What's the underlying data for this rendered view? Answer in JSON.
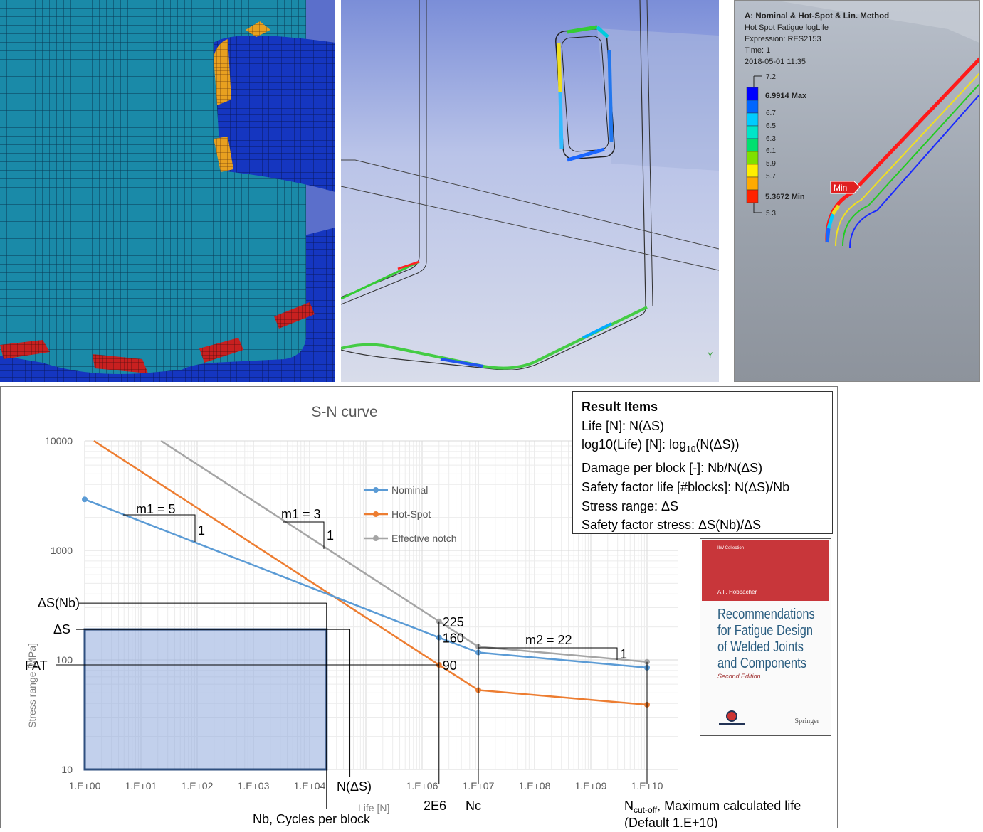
{
  "panel3": {
    "title": "A: Nominal & Hot-Spot & Lin. Method",
    "subtitle": "Hot Spot Fatigue logLife",
    "expression": "Expression: RES2153",
    "time": "Time: 1",
    "date": "2018-05-01 11:35",
    "scale": [
      "7.2",
      "6.9914 Max",
      "6.7",
      "6.5",
      "6.3",
      "6.1",
      "5.9",
      "5.7",
      "5.3672 Min",
      "5.3"
    ],
    "scale_colors": [
      "#0000ff",
      "#0066ff",
      "#00ccff",
      "#00e5c8",
      "#00e070",
      "#80e000",
      "#ffee00",
      "#ffaa00",
      "#ff2200"
    ],
    "min_label": "Min",
    "axis_label": "Y"
  },
  "result_items": {
    "title": "Result Items",
    "line1": "Life [N]: N(ΔS)",
    "line2_a": "log10(Life) [N]: log",
    "line2_sub": "10",
    "line2_b": "(N(ΔS))",
    "line3": "Damage per block [-]: Nb/N(ΔS)",
    "line4": "Safety factor life [#blocks]: N(ΔS)/Nb",
    "line5": "Stress range: ΔS",
    "line6": "Safety factor stress: ΔS(Nb)/ΔS"
  },
  "book": {
    "series": "IIW Collection",
    "author": "A.F. Hobbacher",
    "title_lines": [
      "Recommendations",
      "for Fatigue Design",
      "of Welded Joints",
      "and Components"
    ],
    "edition": "Second Edition",
    "publisher": "Springer"
  },
  "colors": {
    "nominal": "#5b9bd5",
    "hotspot": "#ed7d31",
    "notch": "#a5a5a5",
    "box": "#8faadc"
  },
  "chart_data": {
    "type": "line",
    "title": "S-N curve",
    "xlabel": "Life [N]",
    "ylabel": "Stress range [MPa]",
    "x_scale": "log",
    "y_scale": "log",
    "xlim": [
      1,
      10000000000
    ],
    "ylim": [
      10,
      10000
    ],
    "x_ticks": [
      "1.E+00",
      "1.E+01",
      "1.E+02",
      "1.E+03",
      "1.E+04",
      "1.E+06",
      "1.E+07",
      "1.E+08",
      "1.E+09",
      "1.E+10"
    ],
    "x_tick_values": [
      1,
      10,
      100,
      1000,
      10000,
      1000000,
      10000000,
      100000000,
      1000000000,
      10000000000
    ],
    "y_ticks": [
      "10000",
      "1000",
      "100",
      "10"
    ],
    "y_tick_values": [
      10000,
      1000,
      100,
      10
    ],
    "grid": true,
    "legend_position": "top-center",
    "series": [
      {
        "name": "Nominal",
        "color_key": "nominal",
        "x": [
          1,
          2000000,
          10000000,
          10000000000
        ],
        "y": [
          2924,
          160,
          117,
          85
        ]
      },
      {
        "name": "Hot-Spot",
        "color_key": "hotspot",
        "x": [
          2000000,
          10000000,
          10000000000
        ],
        "y": [
          90,
          53,
          39
        ]
      },
      {
        "name": "Effective notch",
        "color_key": "notch",
        "x": [
          2000000,
          10000000,
          10000000000
        ],
        "y": [
          225,
          132,
          96
        ]
      }
    ],
    "hotspot_upper_line": {
      "x": [
        1,
        2000000
      ],
      "y": [
        11340,
        90
      ]
    },
    "notch_upper_line": {
      "x": [
        1,
        2000000
      ],
      "y": [
        28350,
        225
      ]
    },
    "point_labels": [
      {
        "text": "225",
        "x": 2000000,
        "y": 225
      },
      {
        "text": "160",
        "x": 2000000,
        "y": 160
      },
      {
        "text": "90",
        "x": 2000000,
        "y": 90
      }
    ],
    "slope_annotations": [
      {
        "text": "m1 = 5",
        "num": "1"
      },
      {
        "text": "m1 = 3",
        "num": "1"
      },
      {
        "text": "m2 = 22",
        "num": "1"
      }
    ],
    "annotations": {
      "ds_nb": "ΔS(Nb)",
      "ds": "ΔS",
      "fat": "FAT",
      "n_ds": "N(ΔS)",
      "nb": "Nb, Cycles per block",
      "two_e6": "2E6",
      "nc": "Nc",
      "ncut_main": "N",
      "ncut_sub": "cut-off",
      "ncut_rest": ", Maximum calculated life",
      "ncut_default": "(Default 1.E+10)"
    },
    "ds_nb_value": 330,
    "ds_value": 190,
    "fat_value": 90,
    "nb_value": 20000,
    "n_ds_value": 52000
  }
}
